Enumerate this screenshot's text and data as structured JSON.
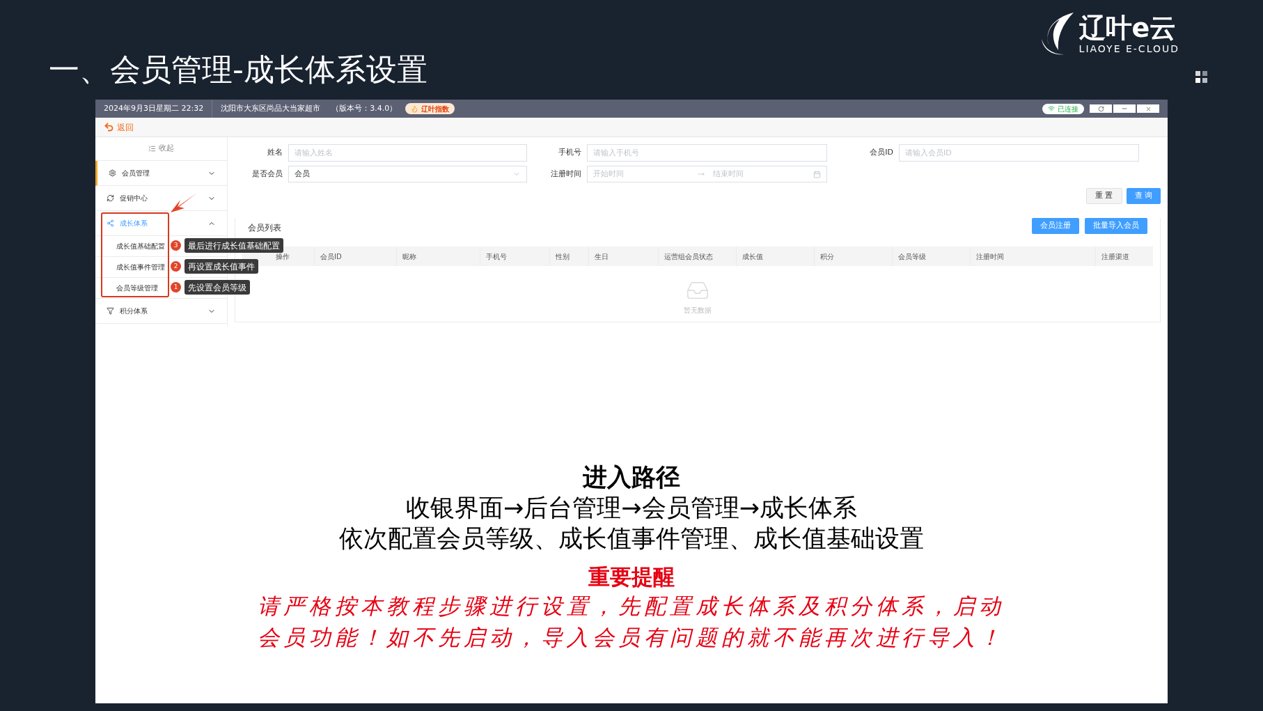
{
  "slide": {
    "title": "一、会员管理-成长体系设置",
    "logo": {
      "name": "辽叶e云",
      "tagline": "LIAOYE E-CLOUD"
    }
  },
  "titlebar": {
    "datetime": "2024年9月3日星期二 22:32",
    "store": "沈阳市大东区尚品大当家超市",
    "version": "（版本号：3.4.0）",
    "badge": "辽叶指数",
    "connection": "已连接"
  },
  "back": "返回",
  "sidebar": {
    "collapse": "收起",
    "items": [
      {
        "label": "会员管理",
        "selected": true,
        "expanded": false
      },
      {
        "label": "促销中心",
        "selected": false,
        "expanded": false
      },
      {
        "label": "成长体系",
        "selected": false,
        "expanded": true,
        "annotated": true,
        "children": [
          {
            "label": "成长值基础配置",
            "step": "3",
            "tip": "最后进行成长值基础配置"
          },
          {
            "label": "成长值事件管理",
            "step": "2",
            "tip": "再设置成长值事件"
          },
          {
            "label": "会员等级管理",
            "step": "1",
            "tip": "先设置会员等级"
          }
        ]
      },
      {
        "label": "积分体系",
        "selected": false,
        "expanded": false
      }
    ]
  },
  "filters": [
    {
      "kind": "text",
      "label": "姓名",
      "placeholder": "请输入姓名"
    },
    {
      "kind": "text",
      "label": "手机号",
      "placeholder": "请输入手机号"
    },
    {
      "kind": "text",
      "label": "会员ID",
      "placeholder": "请输入会员ID"
    },
    {
      "kind": "select",
      "label": "是否会员",
      "value": "会员"
    },
    {
      "kind": "daterange",
      "label": "注册时间",
      "start_placeholder": "开始时间",
      "end_placeholder": "结束时间"
    }
  ],
  "filter_buttons": [
    {
      "label": "重 置",
      "primary": false
    },
    {
      "label": "查 询",
      "primary": true
    }
  ],
  "list": {
    "title": "会员列表",
    "actions": [
      "会员注册",
      "批量导入会员"
    ],
    "columns": [
      "操作",
      "会员ID",
      "昵称",
      "手机号",
      "性别",
      "生日",
      "运营组会员状态",
      "成长值",
      "积分",
      "会员等级",
      "注册时间",
      "注册渠道"
    ],
    "empty": "暂无数据"
  },
  "notes": {
    "heading": "进入路径",
    "lines": [
      "收银界面→后台管理→会员管理→成长体系",
      "依次配置会员等级、成长值事件管理、成长值基础设置"
    ],
    "warning_title": "重要提醒",
    "warning_lines": [
      "请严格按本教程步骤进行设置，先配置成长体系及积分体系，启动",
      "会员功能！如不先启动，导入会员有问题的就不能再次进行导入！"
    ]
  }
}
